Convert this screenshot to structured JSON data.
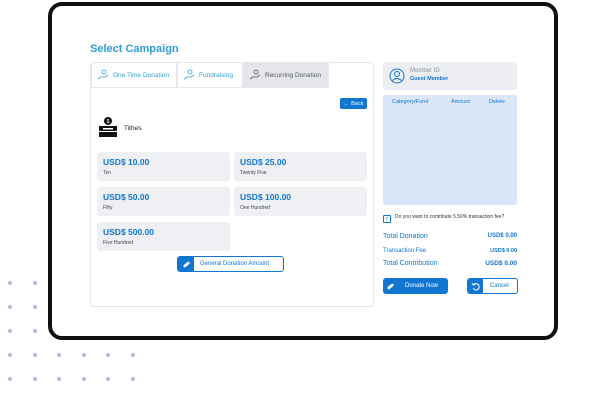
{
  "title": "Select Campaign",
  "tabs": [
    {
      "label": "One Time Donation",
      "icon": "hand-coin-icon"
    },
    {
      "label": "Fundraising",
      "icon": "hand-coin-icon"
    },
    {
      "label": "Recurring Donation",
      "icon": "hand-coin-icon",
      "active": true
    }
  ],
  "back_label": "Back",
  "category": {
    "label": "Tithes",
    "icon": "donation-box-icon"
  },
  "amounts": [
    {
      "value": "USD$ 10.00",
      "words": "Ten"
    },
    {
      "value": "USD$ 25.00",
      "words": "Twenty Five"
    },
    {
      "value": "USD$ 50.00",
      "words": "Fifty"
    },
    {
      "value": "USD$ 100.00",
      "words": "One Hundred"
    },
    {
      "value": "USD$ 500.00",
      "words": "Five Hundred"
    }
  ],
  "general_label": "General Donation Amount",
  "member": {
    "id_label": "Member ID",
    "name": "Guest Member"
  },
  "table_headers": [
    "Category/Fund",
    "Amount",
    "Delete"
  ],
  "contribute": {
    "checked": true,
    "text": "Do you want to contribute 5.50% transaction fee?"
  },
  "summary": {
    "total_donation_label": "Total Donation",
    "total_donation_value": "USD$ 0.00",
    "transaction_fee_label": "Transaction Fee",
    "transaction_fee_value": "USD$ 0.00",
    "total_contribution_label": "Total Contribution",
    "total_contribution_value": "USD$ 0.00"
  },
  "donate_label": "Donate Now",
  "cancel_label": "Cancel",
  "colors": {
    "accent": "#1276d3",
    "title": "#2f9ed8",
    "panel": "#dbe7f9"
  }
}
